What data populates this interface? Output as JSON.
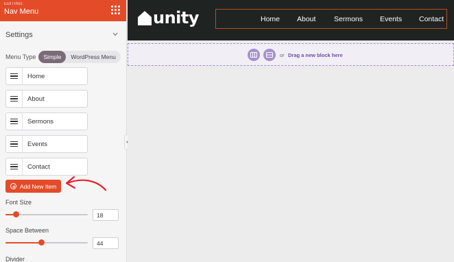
{
  "sidebar": {
    "editing_label": "EDITING:",
    "title": "Nav Menu",
    "section_title": "Settings",
    "menu_type": {
      "label": "Menu Type",
      "options": [
        "Simple",
        "WordPress Menu"
      ],
      "selected": "Simple"
    },
    "menu_items": [
      {
        "label": "Home"
      },
      {
        "label": "About"
      },
      {
        "label": "Sermons"
      },
      {
        "label": "Events"
      },
      {
        "label": "Contact"
      }
    ],
    "add_item_label": "Add New Item",
    "font_size": {
      "label": "Font Size",
      "value": "18",
      "slider_fraction": 0.13
    },
    "space_between": {
      "label": "Space Between",
      "value": "44",
      "slider_fraction": 0.44
    },
    "divider_label": "Divider"
  },
  "site": {
    "logo_text": "unity",
    "nav": [
      "Home",
      "About",
      "Sermons",
      "Events",
      "Contact"
    ]
  },
  "drop_zone": {
    "or_text": "or",
    "text": "Drag a new block here"
  },
  "colors": {
    "accent": "#e44b28",
    "header_bg": "#1f2322",
    "drop_accent": "#a690cf"
  }
}
